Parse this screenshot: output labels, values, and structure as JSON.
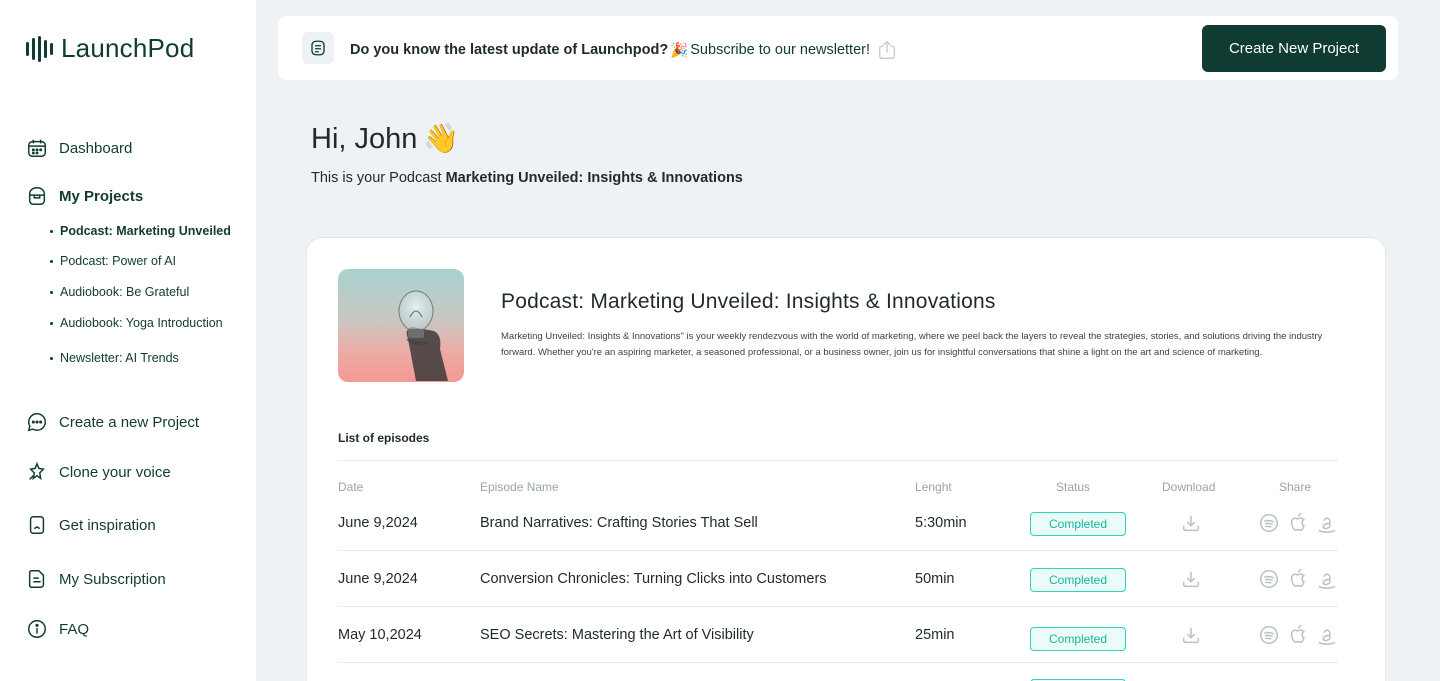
{
  "brand": {
    "name": "LaunchPod"
  },
  "sidebar": {
    "items": [
      {
        "label": "Dashboard",
        "icon": "calendar-icon"
      },
      {
        "label": "My Projects",
        "icon": "folder-icon"
      },
      {
        "label": "Create a new Project",
        "icon": "chat-icon"
      },
      {
        "label": "Clone your voice",
        "icon": "sparkle-icon"
      },
      {
        "label": "Get inspiration",
        "icon": "bookmark-icon"
      },
      {
        "label": "My Subscription",
        "icon": "document-icon"
      },
      {
        "label": "FAQ",
        "icon": "info-icon"
      }
    ],
    "projects": [
      {
        "label": "Podcast: Marketing Unveiled",
        "active": true
      },
      {
        "label": "Podcast: Power of AI",
        "active": false
      },
      {
        "label": "Audiobook: Be Grateful",
        "active": false
      },
      {
        "label": "Audiobook: Yoga Introduction",
        "active": false
      },
      {
        "label": "Newsletter: AI Trends",
        "active": false
      }
    ]
  },
  "topbar": {
    "announcement_bold": "Do you know the latest update of Launchpod?",
    "emoji": "🎉",
    "link": "Subscribe to our newsletter!",
    "create_button": "Create New Project"
  },
  "greeting": {
    "title": "Hi, John",
    "emoji": "👋",
    "subtitle_prefix": "This is your Podcast ",
    "subtitle_bold": "Marketing Unveiled: Insights & Innovations"
  },
  "podcast": {
    "title": "Podcast: Marketing Unveiled: Insights & Innovations",
    "description": "Marketing Unveiled: Insights & Innovations\" is your weekly rendezvous with the world of marketing, where we peel back the layers to reveal the strategies, stories, and solutions driving the industry forward. Whether you're an aspiring marketer, a seasoned professional, or a business owner, join us for insightful conversations that shine a light on the art and science of marketing."
  },
  "episodes": {
    "heading": "List of episodes",
    "columns": [
      "Date",
      "Episode Name",
      "Lenght",
      "Status",
      "Download",
      "Share"
    ],
    "rows": [
      {
        "date": "June 9,2024",
        "name": "Brand Narratives: Crafting Stories That Sell",
        "length": "5:30min",
        "status": "Completed"
      },
      {
        "date": "June 9,2024",
        "name": "Conversion Chronicles: Turning Clicks into Customers",
        "length": "50min",
        "status": "Completed"
      },
      {
        "date": "May 10,2024",
        "name": "SEO Secrets: Mastering the Art of Visibility",
        "length": "25min",
        "status": "Completed"
      }
    ]
  },
  "colors": {
    "primary": "#0f3b33",
    "status_border": "#2fd2bd",
    "status_text": "#19b7a2",
    "background": "#eef2f5"
  }
}
